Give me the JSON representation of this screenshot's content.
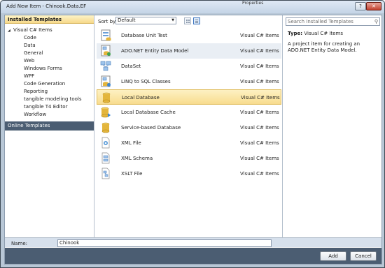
{
  "window": {
    "title": "Add New Item - Chinook.Data.EF",
    "background_text": "Properties",
    "help_label": "?",
    "close_label": "✕"
  },
  "left": {
    "installed_header": "Installed Templates",
    "tree_root": "Visual C# Items",
    "tree_items": [
      "Code",
      "Data",
      "General",
      "Web",
      "Windows Forms",
      "WPF",
      "Code Generation",
      "Reporting",
      "tangible modeling tools",
      "tangible T4 Editor",
      "Workflow"
    ],
    "online_templates": "Online Templates"
  },
  "sort": {
    "label": "Sort by:",
    "value": "Default"
  },
  "templates": [
    {
      "name": "Database Unit Test",
      "lang": "Visual C# Items",
      "icon": "database-unit-test-icon"
    },
    {
      "name": "ADO.NET Entity Data Model",
      "lang": "Visual C# Items",
      "icon": "entity-data-model-icon"
    },
    {
      "name": "DataSet",
      "lang": "Visual C# Items",
      "icon": "dataset-icon"
    },
    {
      "name": "LINQ to SQL Classes",
      "lang": "Visual C# Items",
      "icon": "linq-to-sql-icon"
    },
    {
      "name": "Local Database",
      "lang": "Visual C# Items",
      "icon": "local-database-icon"
    },
    {
      "name": "Local Database Cache",
      "lang": "Visual C# Items",
      "icon": "local-database-cache-icon"
    },
    {
      "name": "Service-based Database",
      "lang": "Visual C# Items",
      "icon": "service-database-icon"
    },
    {
      "name": "XML File",
      "lang": "Visual C# Items",
      "icon": "xml-file-icon"
    },
    {
      "name": "XML Schema",
      "lang": "Visual C# Items",
      "icon": "xml-schema-icon"
    },
    {
      "name": "XSLT File",
      "lang": "Visual C# Items",
      "icon": "xslt-file-icon"
    }
  ],
  "selected_index": 4,
  "hover_index": 1,
  "details": {
    "search_placeholder": "Search Installed Templates",
    "type_label": "Type:",
    "type_value": "Visual C# Items",
    "description": "A project item for creating an ADO.NET Entity Data Model."
  },
  "name_field": {
    "label": "Name:",
    "value": "Chinook"
  },
  "buttons": {
    "add": "Add",
    "cancel": "Cancel"
  },
  "colors": {
    "selection": "#f8dc8e",
    "online_bar": "#4b5d72",
    "db_gold": "#e3b53c"
  }
}
